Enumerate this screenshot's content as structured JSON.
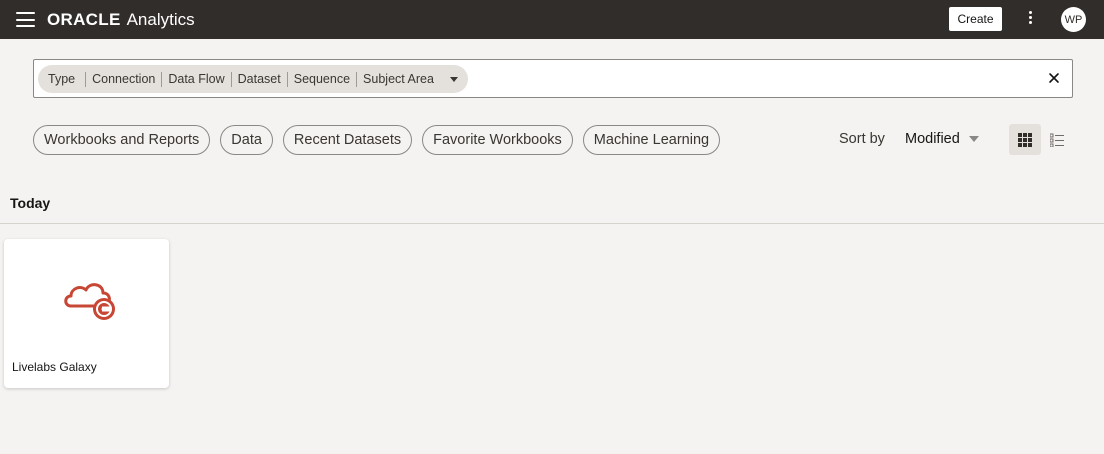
{
  "header": {
    "logo": "ORACLE",
    "product": "Analytics",
    "create_label": "Create",
    "avatar_initials": "WP"
  },
  "search": {
    "filter_options": [
      "Type",
      "Connection",
      "Data Flow",
      "Dataset",
      "Sequence",
      "Subject Area"
    ]
  },
  "chips": [
    "Workbooks and Reports",
    "Data",
    "Recent Datasets",
    "Favorite Workbooks",
    "Machine Learning"
  ],
  "sort": {
    "label": "Sort by",
    "value": "Modified"
  },
  "section": {
    "title": "Today"
  },
  "cards": [
    {
      "title": "Livelabs Galaxy",
      "icon": "cloud-connection-icon",
      "icon_color": "#c74634"
    }
  ],
  "colors": {
    "topbar": "#312d2a",
    "background": "#f4f3f1",
    "accent": "#c74634"
  }
}
